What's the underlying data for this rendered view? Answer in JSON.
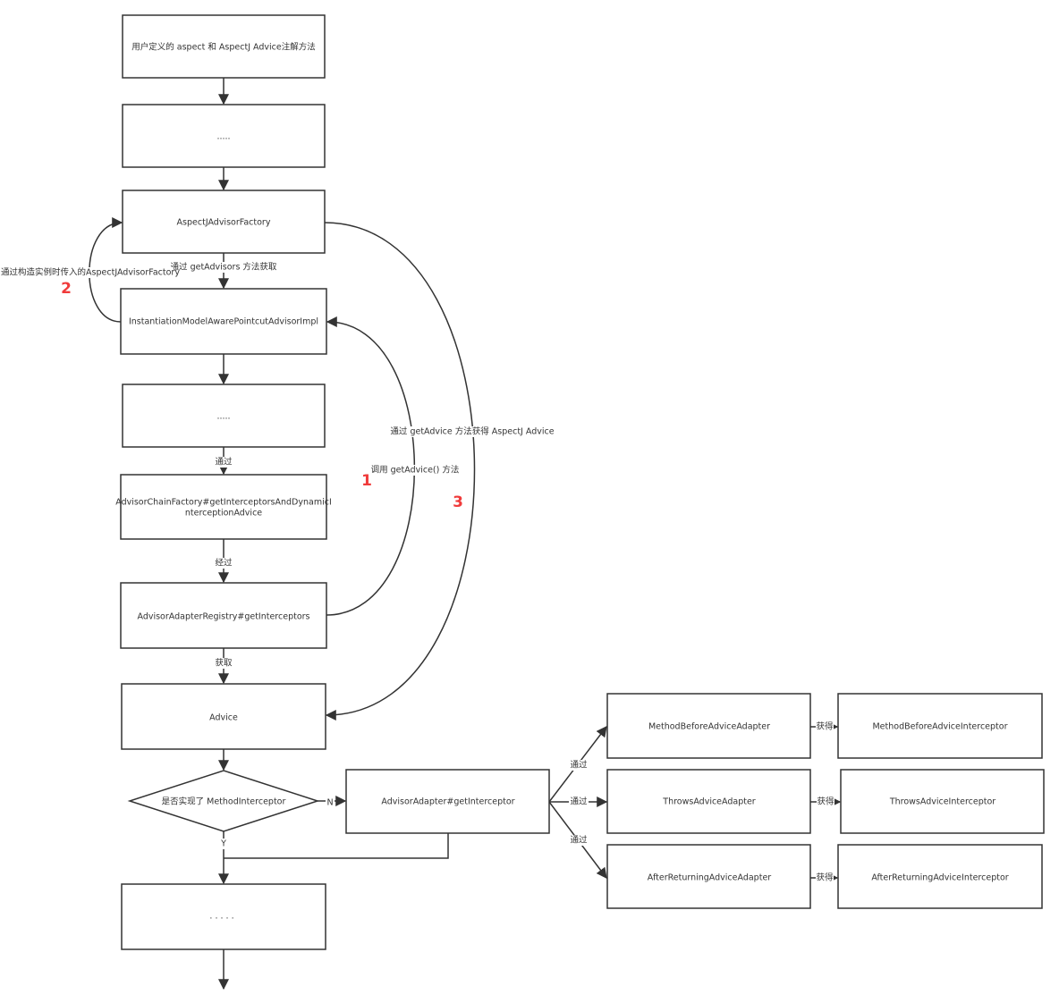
{
  "nodes": {
    "user_aspect": "用户定义的 aspect 和  AspectJ Advice注解方法",
    "ellipsis_1": ".....",
    "aspectj_advisor_factory": "AspectJAdvisorFactory",
    "instantiation_model": "InstantiationModelAwarePointcutAdvisorImpl",
    "ellipsis_2": ".....",
    "advisor_chain_factory_line1": "AdvisorChainFactory#getInterceptorsAndDynamicI",
    "advisor_chain_factory_line2": "nterceptionAdvice",
    "advisor_adapter_registry": "AdvisorAdapterRegistry#getInterceptors",
    "advice": "Advice",
    "decision": "是否实现了 MethodInterceptor",
    "advisor_adapter": "AdvisorAdapter#getInterceptor",
    "method_before_adapter": "MethodBeforeAdviceAdapter",
    "throws_adapter": "ThrowsAdviceAdapter",
    "after_returning_adapter": "AfterReturningAdviceAdapter",
    "method_before_interceptor": "MethodBeforeAdviceInterceptor",
    "throws_interceptor": "ThrowsAdviceInterceptor",
    "after_returning_interceptor": "AfterReturningAdviceInterceptor",
    "ellipsis_3": "· · · · ·"
  },
  "edges": {
    "via_get_advisors": "通过 getAdvisors 方法获取",
    "via_constructor": "通过构造实例时传入的AspectJAdvisorFactory",
    "via_get_advice_aspectj": "通过 getAdvice 方法获得 AspectJ Advice",
    "call_get_advice": "调用 getAdvice() 方法",
    "via": "通过",
    "pass_through": "经过",
    "obtain": "获取",
    "no": "N",
    "yes": "Y",
    "via_mb": "通过",
    "via_th": "通过",
    "via_ar": "通过",
    "get_mb": "获得",
    "get_th": "获得",
    "get_ar": "获得"
  },
  "step_numbers": {
    "one": "1",
    "two": "2",
    "three": "3"
  },
  "colors": {
    "line": "#333333",
    "step_number": "#f03b3b"
  }
}
